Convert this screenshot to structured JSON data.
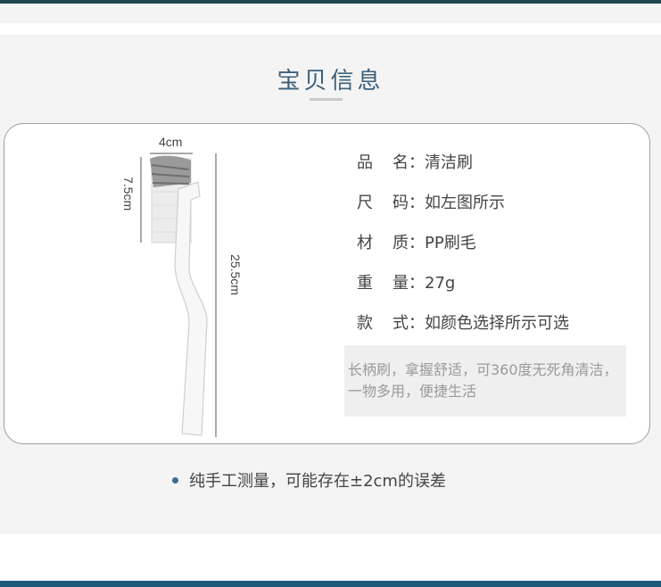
{
  "section": {
    "title": "宝贝信息"
  },
  "dimensions": {
    "width": "4cm",
    "head_height": "7.5cm",
    "total_length": "25.5cm"
  },
  "specs": [
    {
      "label_a": "品",
      "label_b": "名",
      "sep": "：",
      "value": "清洁刷"
    },
    {
      "label_a": "尺",
      "label_b": "码",
      "sep": "：",
      "value": "如左图所示"
    },
    {
      "label_a": "材",
      "label_b": "质",
      "sep": "：",
      "value": "PP刷毛"
    },
    {
      "label_a": "重",
      "label_b": "量",
      "sep": "：",
      "value": "27g"
    },
    {
      "label_a": "款",
      "label_b": "式",
      "sep": "：",
      "value": "如颜色选择所示可选"
    }
  ],
  "description": "长柄刷，拿握舒适，可360度无死角清洁，一物多用，便捷生活",
  "note": "纯手工测量，可能存在±2cm的误差",
  "colors": {
    "title": "#3d5f79",
    "top_bar": "#20474f",
    "bottom_bar": "#1f5a7a",
    "bullet": "#3a6b93"
  }
}
